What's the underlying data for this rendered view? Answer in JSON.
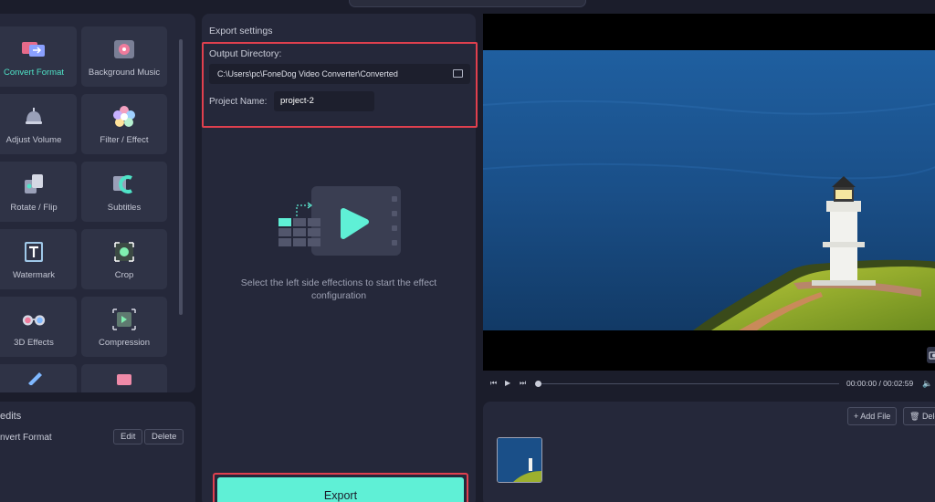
{
  "tools": [
    {
      "label": "Convert Format",
      "icon": "convert-format-icon",
      "active": true
    },
    {
      "label": "Background Music",
      "icon": "background-music-icon",
      "active": false
    },
    {
      "label": "Adjust Volume",
      "icon": "adjust-volume-icon",
      "active": false
    },
    {
      "label": "Filter / Effect",
      "icon": "filter-effect-icon",
      "active": false
    },
    {
      "label": "Rotate / Flip",
      "icon": "rotate-flip-icon",
      "active": false
    },
    {
      "label": "Subtitles",
      "icon": "subtitles-icon",
      "active": false
    },
    {
      "label": "Watermark",
      "icon": "watermark-icon",
      "active": false
    },
    {
      "label": "Crop",
      "icon": "crop-icon",
      "active": false
    },
    {
      "label": "3D Effects",
      "icon": "3d-effects-icon",
      "active": false
    },
    {
      "label": "Compression",
      "icon": "compression-icon",
      "active": false
    }
  ],
  "edits": {
    "title": "edits",
    "item": "nvert Format",
    "edit_label": "Edit",
    "delete_label": "Delete"
  },
  "export_settings": {
    "title": "Export settings",
    "output_directory_label": "Output Directory:",
    "output_directory_value": "C:\\Users\\pc\\FoneDog Video Converter\\Converted",
    "project_name_label": "Project Name:",
    "project_name_value": "project-2",
    "hint": "Select the left side effections to start the effect configuration",
    "export_label": "Export"
  },
  "player": {
    "time": "00:00:00 / 00:02:59",
    "progress": 0
  },
  "files": {
    "add_file_label": "Add File",
    "delete_label": "Delet"
  },
  "colors": {
    "accent": "#5ff0d6",
    "highlight": "#e0404e",
    "panel": "#25283a",
    "background": "#1b1d2b"
  }
}
